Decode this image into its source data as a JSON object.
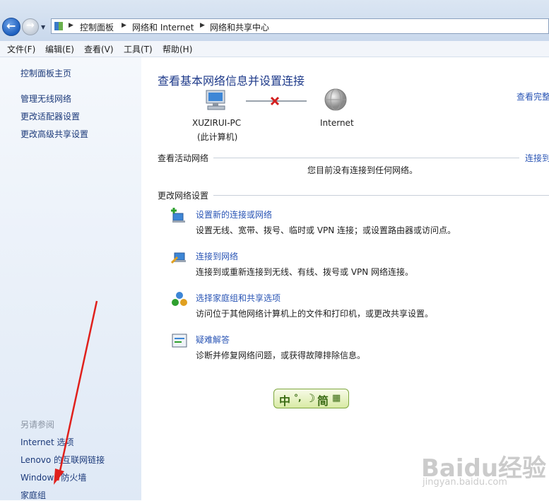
{
  "address": {
    "crumbs": [
      "控制面板",
      "网络和 Internet",
      "网络和共享中心"
    ]
  },
  "menubar": [
    "文件(F)",
    "编辑(E)",
    "查看(V)",
    "工具(T)",
    "帮助(H)"
  ],
  "sidebar": {
    "home": "控制面板主页",
    "links": [
      "管理无线网络",
      "更改适配器设置",
      "更改高级共享设置"
    ],
    "see_also_title": "另请参阅",
    "see_also": [
      "Internet 选项",
      "Lenovo 的互联网链接",
      "Windows 防火墙",
      "家庭组"
    ]
  },
  "main": {
    "title": "查看基本网络信息并设置连接",
    "see_full_map": "查看完整",
    "computer_name": "XUZIRUI-PC",
    "computer_sub": "(此计算机)",
    "internet_label": "Internet",
    "active_networks_label": "查看活动网络",
    "connect_to": "连接到",
    "no_connection": "您目前没有连接到任何网络。",
    "change_settings_label": "更改网络设置",
    "tasks": [
      {
        "link": "设置新的连接或网络",
        "desc": "设置无线、宽带、拨号、临时或 VPN 连接；或设置路由器或访问点。"
      },
      {
        "link": "连接到网络",
        "desc": "连接到或重新连接到无线、有线、拨号或 VPN 网络连接。"
      },
      {
        "link": "选择家庭组和共享选项",
        "desc": "访问位于其他网络计算机上的文件和打印机，或更改共享设置。"
      },
      {
        "link": "疑难解答",
        "desc": "诊断并修复网络问题，或获得故障排除信息。"
      }
    ],
    "ime": {
      "zh": "中",
      "jian": "简"
    }
  },
  "watermark": {
    "brand": "Baidu经验",
    "url": "jingyan.baidu.com"
  },
  "colors": {
    "link": "#2a55b5",
    "title": "#1e3a8a",
    "annotation_arrow": "#e0201c"
  }
}
